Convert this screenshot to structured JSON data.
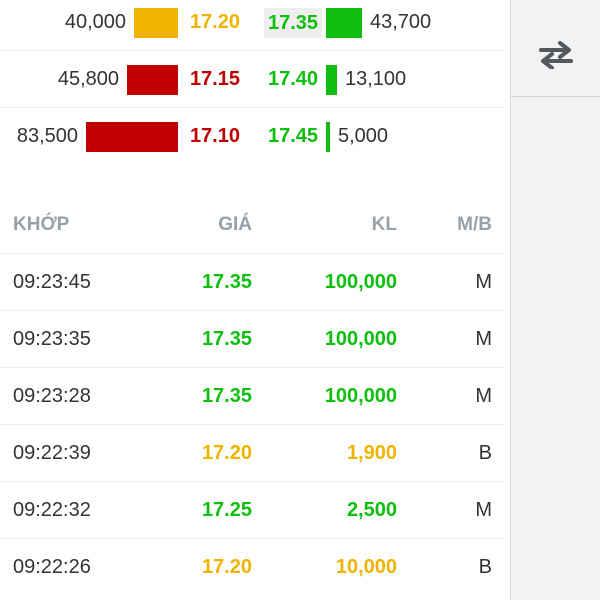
{
  "colors": {
    "up": "#0fbf0f",
    "reference": "#f0b400",
    "down": "#c00000",
    "text": "#333333",
    "header": "#9aa0a8"
  },
  "order_book": {
    "rows": [
      {
        "bid_volume": "40,000",
        "bid_price": "17.20",
        "bid_color": "reference",
        "bid_fill": 0.48,
        "ask_price": "17.35",
        "ask_color": "up",
        "ask_fill": 0.52,
        "ask_volume": "43,700"
      },
      {
        "bid_volume": "45,800",
        "bid_price": "17.15",
        "bid_color": "down",
        "bid_fill": 0.55,
        "ask_price": "17.40",
        "ask_color": "up",
        "ask_fill": 0.16,
        "ask_volume": "13,100"
      },
      {
        "bid_volume": "83,500",
        "bid_price": "17.10",
        "bid_color": "down",
        "bid_fill": 1.0,
        "ask_price": "17.45",
        "ask_color": "up",
        "ask_fill": 0.06,
        "ask_volume": "5,000"
      }
    ]
  },
  "trades": {
    "headers": {
      "time": "KHỚP",
      "price": "GIÁ",
      "volume": "KL",
      "side": "M/B"
    },
    "rows": [
      {
        "time": "09:23:45",
        "price": "17.35",
        "volume": "100,000",
        "side": "M",
        "color": "up"
      },
      {
        "time": "09:23:35",
        "price": "17.35",
        "volume": "100,000",
        "side": "M",
        "color": "up"
      },
      {
        "time": "09:23:28",
        "price": "17.35",
        "volume": "100,000",
        "side": "M",
        "color": "up"
      },
      {
        "time": "09:22:39",
        "price": "17.20",
        "volume": "1,900",
        "side": "B",
        "color": "reference"
      },
      {
        "time": "09:22:32",
        "price": "17.25",
        "volume": "2,500",
        "side": "M",
        "color": "up"
      },
      {
        "time": "09:22:26",
        "price": "17.20",
        "volume": "10,000",
        "side": "B",
        "color": "reference"
      }
    ]
  },
  "side_panel": {
    "swap_icon": "swap-arrows-icon"
  }
}
